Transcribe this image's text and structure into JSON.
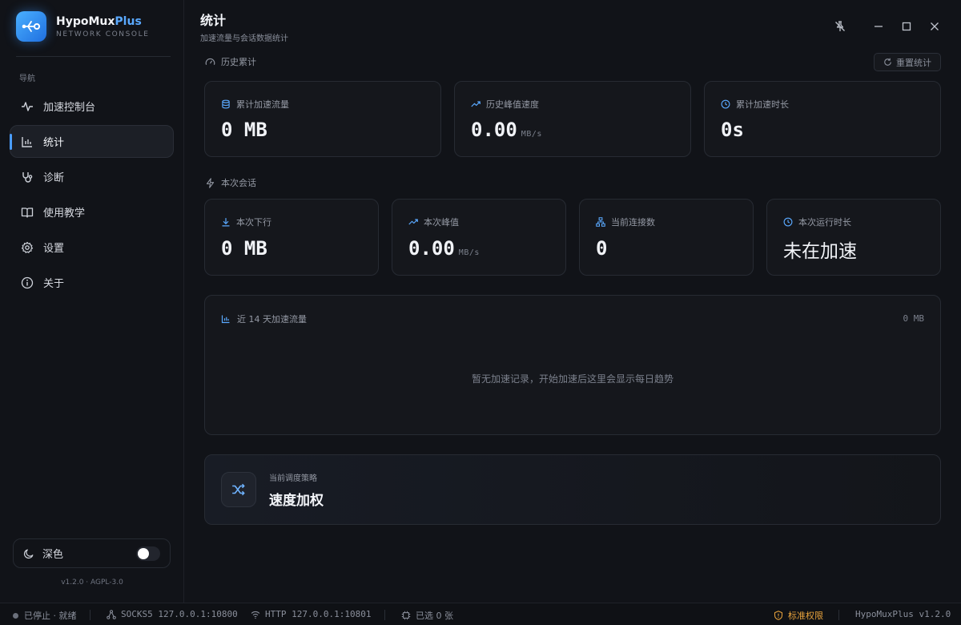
{
  "app": {
    "name_main": "HypoMux",
    "name_accent": "Plus",
    "subtitle": "NETWORK CONSOLE",
    "version": "v1.2.0 · AGPL-3.0"
  },
  "sidebar": {
    "nav_title": "导航",
    "items": [
      {
        "label": "加速控制台",
        "icon": "activity-icon"
      },
      {
        "label": "统计",
        "icon": "bar-chart-icon",
        "active": true
      },
      {
        "label": "诊断",
        "icon": "stethoscope-icon"
      },
      {
        "label": "使用教学",
        "icon": "book-icon"
      },
      {
        "label": "设置",
        "icon": "gear-icon"
      },
      {
        "label": "关于",
        "icon": "info-icon"
      }
    ],
    "theme_label": "深色",
    "theme_toggle_on": true
  },
  "header": {
    "title": "统计",
    "subtitle": "加速流量与会话数据统计"
  },
  "history": {
    "section_label": "历史累计",
    "reset_label": "重置统计",
    "cards": [
      {
        "label": "累计加速流量",
        "value": "0 MB",
        "unit": "",
        "icon": "database-icon"
      },
      {
        "label": "历史峰值速度",
        "value": "0.00",
        "unit": "MB/s",
        "icon": "trending-up-icon"
      },
      {
        "label": "累计加速时长",
        "value": "0s",
        "unit": "",
        "icon": "clock-icon"
      }
    ]
  },
  "session": {
    "section_label": "本次会话",
    "cards": [
      {
        "label": "本次下行",
        "value": "0 MB",
        "unit": "",
        "icon": "download-icon"
      },
      {
        "label": "本次峰值",
        "value": "0.00",
        "unit": "MB/s",
        "icon": "trending-up-icon"
      },
      {
        "label": "当前连接数",
        "value": "0",
        "unit": "",
        "icon": "network-icon"
      },
      {
        "label": "本次运行时长",
        "value": "未在加速",
        "unit": "",
        "icon": "clock-icon"
      }
    ]
  },
  "chart": {
    "title": "近 14 天加速流量",
    "total": "0 MB",
    "empty_text": "暂无加速记录，开始加速后这里会显示每日趋势"
  },
  "strategy": {
    "label": "当前调度策略",
    "value": "速度加权"
  },
  "statusbar": {
    "state": "已停止 · 就绪",
    "socks": "SOCKS5 127.0.0.1:10800",
    "http": "HTTP 127.0.0.1:10801",
    "selected": "已选 0 张",
    "permission": "标准权限",
    "version": "HypoMuxPlus v1.2.0"
  },
  "colors": {
    "accent": "#4a9dff",
    "background": "#111318",
    "card": "#15171c",
    "warning": "#e8a33c"
  }
}
